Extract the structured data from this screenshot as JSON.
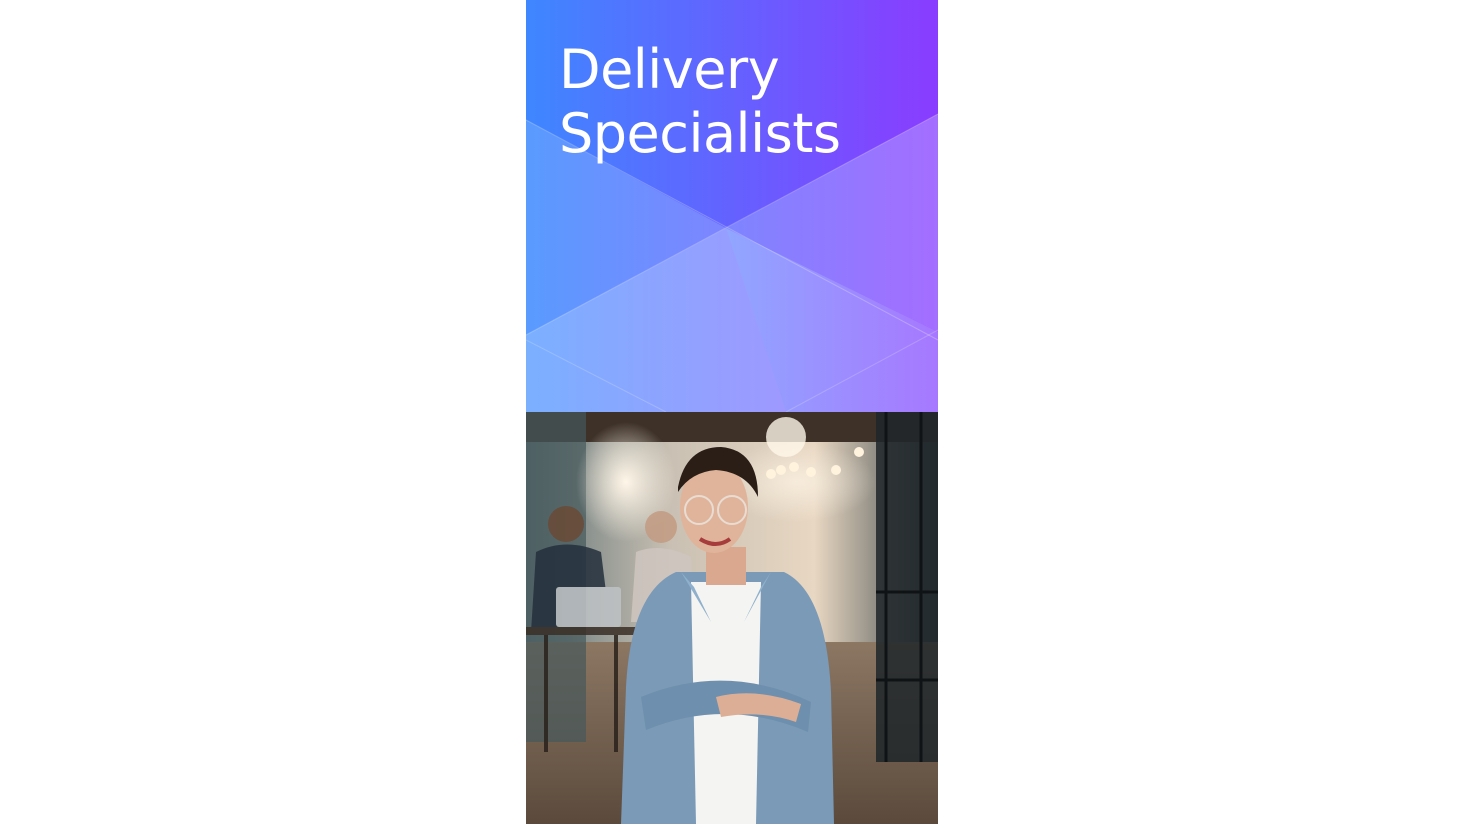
{
  "banner": {
    "title_line_1": "Delivery",
    "title_line_2": "Specialists"
  },
  "colors": {
    "gradient_start": "#3d86ff",
    "gradient_end": "#8a3dff",
    "page_background": "#ffffff",
    "title_text": "#ffffff"
  },
  "photo": {
    "subject": "smiling woman with glasses in denim shirt, arms crossed, in office with colleagues at laptop behind"
  }
}
